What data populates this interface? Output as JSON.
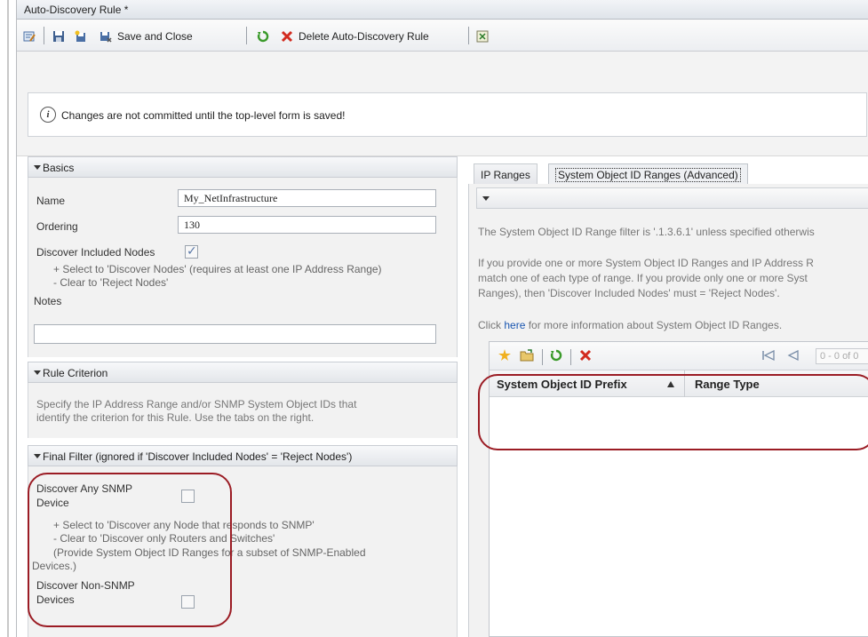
{
  "window": {
    "title": "Auto-Discovery Rule *"
  },
  "toolbar": {
    "save_close_label": "Save and Close",
    "delete_label": "Delete Auto-Discovery Rule"
  },
  "notice": {
    "message": "Changes are not committed until the top-level form is saved!"
  },
  "basics": {
    "header": "Basics",
    "name_label": "Name",
    "name_value": "My_NetInfrastructure",
    "ordering_label": "Ordering",
    "ordering_value": "130",
    "discover_included_label": "Discover Included Nodes",
    "discover_included_checked": true,
    "hint_line1": "+ Select to 'Discover Nodes' (requires at least one IP Address Range)",
    "hint_line2": "- Clear to 'Reject Nodes'",
    "notes_label": "Notes",
    "notes_value": ""
  },
  "rule_criterion": {
    "header": "Rule Criterion",
    "text_line1": "Specify the IP Address Range and/or SNMP System Object IDs that",
    "text_line2": "identify the criterion for this Rule. Use the tabs on the right."
  },
  "final_filter": {
    "header": "Final Filter (ignored if 'Discover Included Nodes' = 'Reject Nodes')",
    "snmp_label_line1": "Discover Any SNMP",
    "snmp_label_line2": "Device",
    "snmp_checked": false,
    "hint_line1": "+ Select to 'Discover any Node that responds to SNMP'",
    "hint_line2": "- Clear to 'Discover only Routers and Switches'",
    "hint_line3": "(Provide System Object ID Ranges for a subset of SNMP-Enabled",
    "hint_line4": "Devices.)",
    "non_snmp_label_line1": "Discover Non-SNMP",
    "non_snmp_label_line2": "Devices",
    "non_snmp_checked": false
  },
  "tabs": [
    {
      "label": "IP Ranges",
      "active": false
    },
    {
      "label": "System Object ID Ranges (Advanced)",
      "active": true
    }
  ],
  "right_panel": {
    "line1": "The System Object ID Range filter is '.1.3.6.1' unless specified otherwis",
    "line2": "If you provide one or more System Object ID Ranges and IP Address R",
    "line3": "match one of each type of range. If you provide only one or more Syst",
    "line4": "Ranges), then 'Discover Included Nodes' must = 'Reject Nodes'.",
    "link_prefix": "Click ",
    "link_text": "here",
    "link_suffix": " for more information about System Object ID Ranges."
  },
  "grid": {
    "pager_text": "0 - 0 of 0",
    "columns": [
      "System Object ID Prefix",
      "Range Type"
    ],
    "rows": []
  },
  "colors": {
    "annotation_red": "#9b1c24",
    "link_blue": "#1a56b0"
  }
}
